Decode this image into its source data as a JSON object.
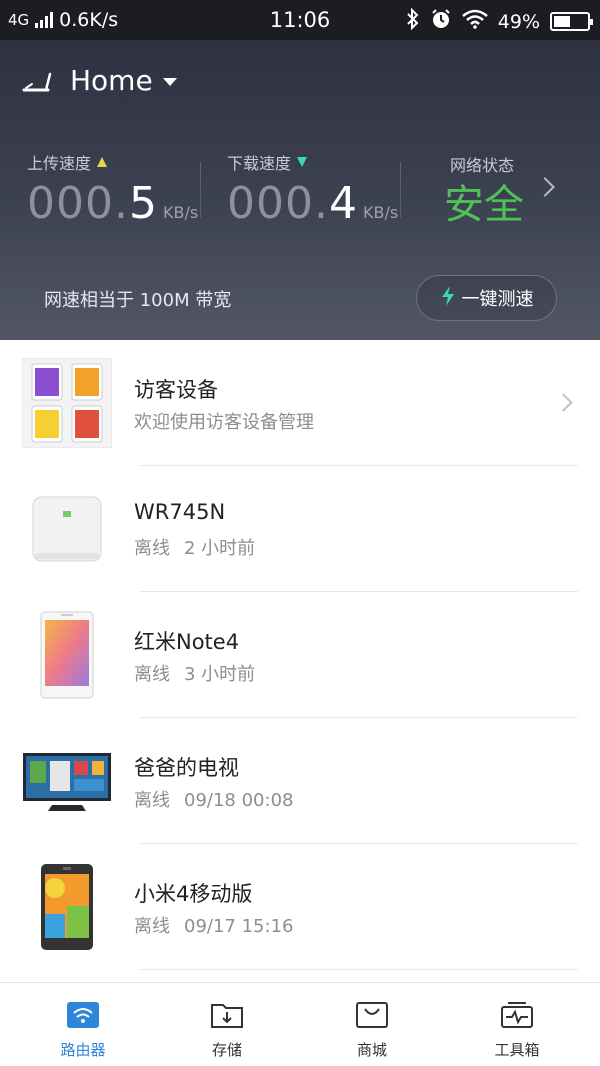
{
  "status_bar": {
    "network": "4G",
    "speed": "0.6K/s",
    "time": "11:06",
    "battery": "49%",
    "battery_level": 0.49
  },
  "header": {
    "title": "Home",
    "upload_label": "上传速度",
    "upload_zero": "000.",
    "upload_value": "5",
    "upload_unit": "KB/s",
    "download_label": "下载速度",
    "download_zero": "000.",
    "download_value": "4",
    "download_unit": "KB/s",
    "network_status_label": "网络状态",
    "network_status_value": "安全",
    "bandwidth_text": "网速相当于 100M 带宽",
    "speedtest_label": "一键测速"
  },
  "devices": [
    {
      "title": "访客设备",
      "status": "欢迎使用访客设备管理",
      "time": ""
    },
    {
      "title": "WR745N",
      "status": "离线",
      "time": "2 小时前"
    },
    {
      "title": "红米Note4",
      "status": "离线",
      "time": "3 小时前"
    },
    {
      "title": "爸爸的电视",
      "status": "离线",
      "time": "09/18 00:08"
    },
    {
      "title": "小米4移动版",
      "status": "离线",
      "time": "09/17 15:16"
    }
  ],
  "tabs": [
    {
      "label": "路由器",
      "icon": "router-wifi-icon",
      "active": true
    },
    {
      "label": "存储",
      "icon": "storage-folder-icon",
      "active": false
    },
    {
      "label": "商城",
      "icon": "shop-bag-icon",
      "active": false
    },
    {
      "label": "工具箱",
      "icon": "toolbox-icon",
      "active": false
    }
  ],
  "colors": {
    "accent": "#2f86d8",
    "safe_green": "#4fc256",
    "upload_arrow": "#e8d44d",
    "download_arrow": "#3ad9b6",
    "speedtest_bolt": "#3ad9b6"
  }
}
